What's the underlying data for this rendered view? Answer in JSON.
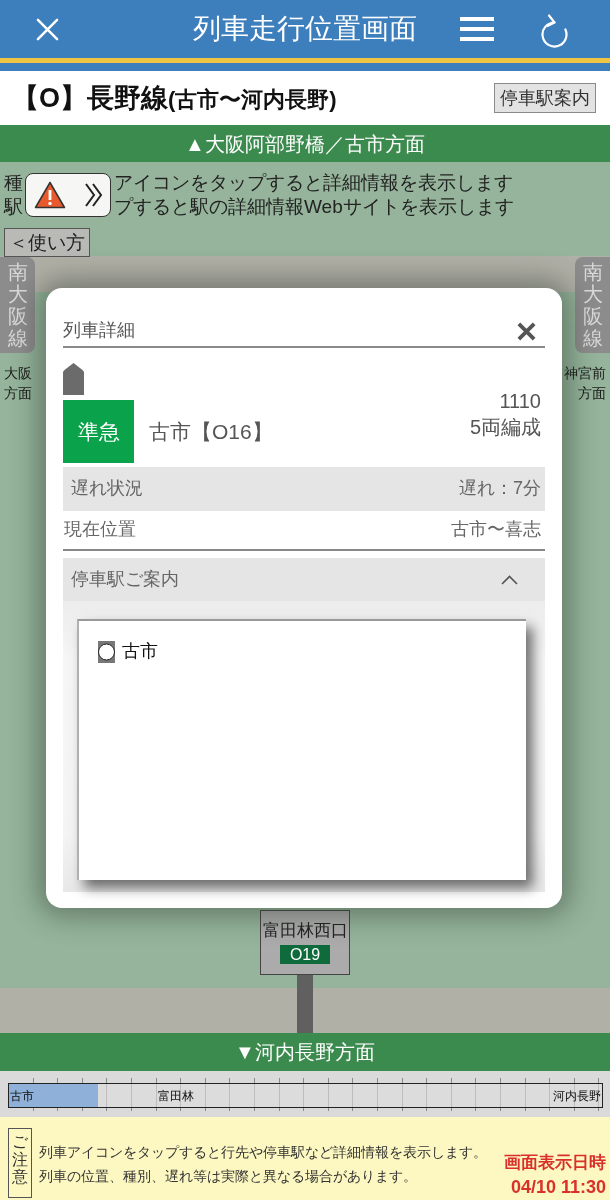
{
  "header": {
    "title": "列車走行位置画面"
  },
  "line": {
    "name": "【O】長野線",
    "section": "(古市〜河内長野)",
    "stops_button": "停車駅案内"
  },
  "direction_top": "▲大阪阿部野橋／古市方面",
  "notices": [
    {
      "before": "種",
      "after": "アイコンをタップすると詳細情報を表示します"
    },
    {
      "before": "駅",
      "after": "プすると駅の詳細情報Webサイトを表示します"
    }
  ],
  "usage_button": "＜使い方",
  "side_lines": [
    {
      "name": "南大阪線",
      "direction": [
        "大阪",
        "方面"
      ]
    },
    {
      "name": "南大阪線",
      "direction": [
        "神宮前",
        "方面"
      ]
    }
  ],
  "station": {
    "name": "富田林西口",
    "code": "O19"
  },
  "train_detail": {
    "title": "列車詳細",
    "type": "準急",
    "destination": "古市【O16】",
    "number": "1110",
    "cars": "5両編成",
    "rows": [
      {
        "label": "遅れ状況",
        "value": "遅れ：7分"
      },
      {
        "label": "現在位置",
        "value": "古市〜喜志"
      }
    ],
    "stops_panel": {
      "title": "停車駅ご案内",
      "expanded": true,
      "stations": [
        "古市"
      ]
    }
  },
  "direction_bottom": "▼河内長野方面",
  "route_strip": {
    "stations": [
      "古市",
      "富田林",
      "河内長野"
    ]
  },
  "caution": {
    "label": "ご注意",
    "lines": [
      "列車アイコンをタップすると行先や停車駅など詳細情報を表示します。",
      "列車の位置、種別、遅れ等は実際と異なる場合があります。"
    ],
    "timestamp_label": "画面表示日時",
    "timestamp": "04/10 11:30"
  }
}
